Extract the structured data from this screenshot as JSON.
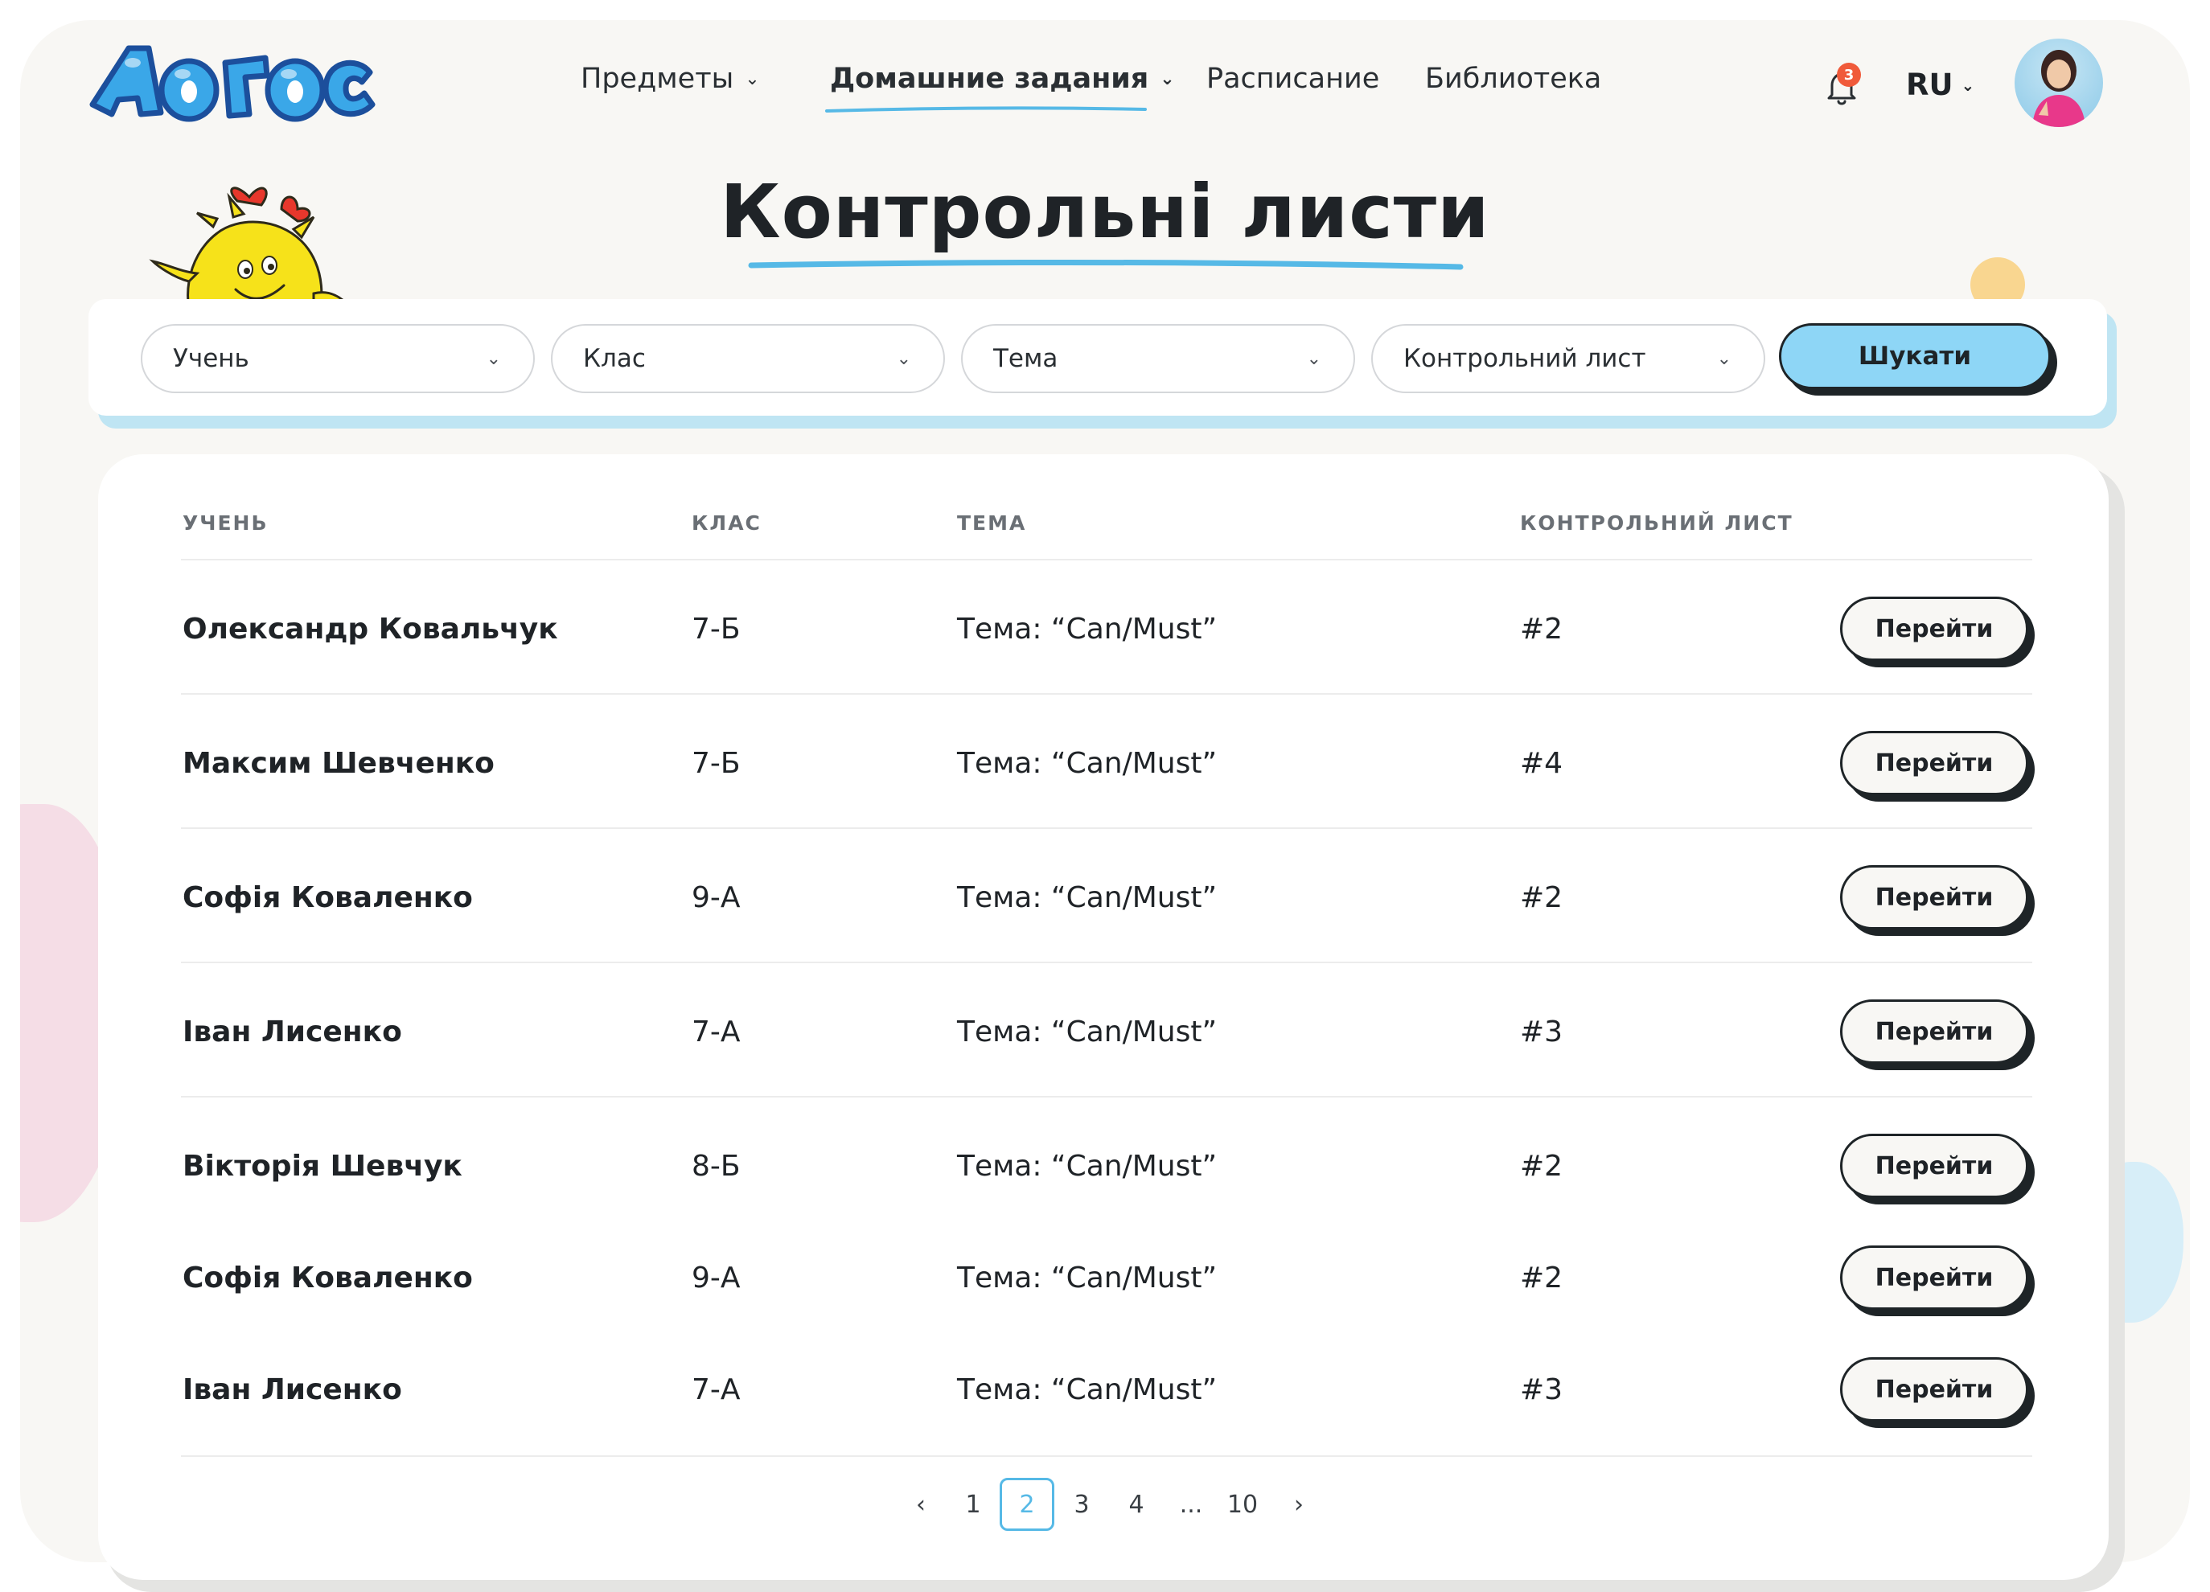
{
  "header": {
    "nav": [
      {
        "label": "Предметы",
        "has_dropdown": true,
        "active": false
      },
      {
        "label": "Домашние задания",
        "has_dropdown": true,
        "active": true
      },
      {
        "label": "Расписание",
        "has_dropdown": false,
        "active": false
      },
      {
        "label": "Библиотека",
        "has_dropdown": false,
        "active": false
      }
    ],
    "notifications_count": "3",
    "language": "RU",
    "icons": {
      "bell": "bell-icon",
      "chevron": "chevron-down-icon",
      "avatar": "user-avatar"
    }
  },
  "page": {
    "title": "Контрольні листи"
  },
  "filters": {
    "student_placeholder": "Учень",
    "class_placeholder": "Клас",
    "topic_placeholder": "Тема",
    "sheet_placeholder": "Контрольний лист",
    "search_label": "Шукати"
  },
  "table": {
    "headers": [
      "УЧЕНЬ",
      "КЛАС",
      "ТЕМА",
      "КОНТРОЛЬНИЙ ЛИСТ"
    ],
    "action_label": "Перейти",
    "rows": [
      {
        "student": "Олександр Ковальчук",
        "class": "7-Б",
        "topic": "Тема: “Can/Must”",
        "sheet": "#2"
      },
      {
        "student": "Максим Шевченко",
        "class": "7-Б",
        "topic": "Тема: “Can/Must”",
        "sheet": "#4"
      },
      {
        "student": "Софія Коваленко",
        "class": "9-А",
        "topic": "Тема: “Can/Must”",
        "sheet": "#2"
      },
      {
        "student": "Іван Лисенко",
        "class": "7-А",
        "topic": "Тема: “Can/Must”",
        "sheet": "#3"
      },
      {
        "student": "Вікторія Шевчук",
        "class": "8-Б",
        "topic": "Тема: “Can/Must”",
        "sheet": "#2"
      },
      {
        "student": "Софія Коваленко",
        "class": "9-А",
        "topic": "Тема: “Can/Must”",
        "sheet": "#2"
      },
      {
        "student": "Іван Лисенко",
        "class": "7-А",
        "topic": "Тема: “Can/Must”",
        "sheet": "#3"
      }
    ]
  },
  "pagination": {
    "prev": "‹",
    "next": "›",
    "pages": [
      "1",
      "2",
      "3",
      "4",
      "...",
      "10"
    ],
    "current": "2"
  },
  "colors": {
    "accent_blue": "#8ed6f6",
    "underline_blue": "#56b9e6",
    "dark": "#1e2427",
    "background": "#f8f7f4",
    "badge_red": "#f05a3a"
  }
}
